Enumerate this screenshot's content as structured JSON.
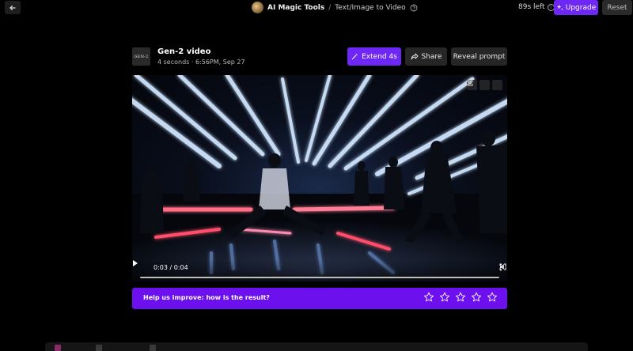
{
  "topbar": {
    "app_name": "AI Magic Tools",
    "separator": "/",
    "page_name": "Text/Image to Video",
    "time_left": "89s left",
    "upgrade_label": "Upgrade",
    "reset_label": "Reset"
  },
  "video": {
    "thumb_text": "GEN-2",
    "title": "Gen-2 video",
    "meta": "4 seconds · 6:56PM, Sep 27",
    "extend_label": "Extend 4s",
    "share_label": "Share",
    "reveal_label": "Reveal prompt",
    "timecode": "0:03 / 0:04",
    "progress": 0.75
  },
  "feedback": {
    "prompt": "Help us improve: how is the result?",
    "star_count": 5
  },
  "colors": {
    "accent": "#6d28f5",
    "feedback_bg": "#6d10ee",
    "button_dark": "#262626"
  }
}
